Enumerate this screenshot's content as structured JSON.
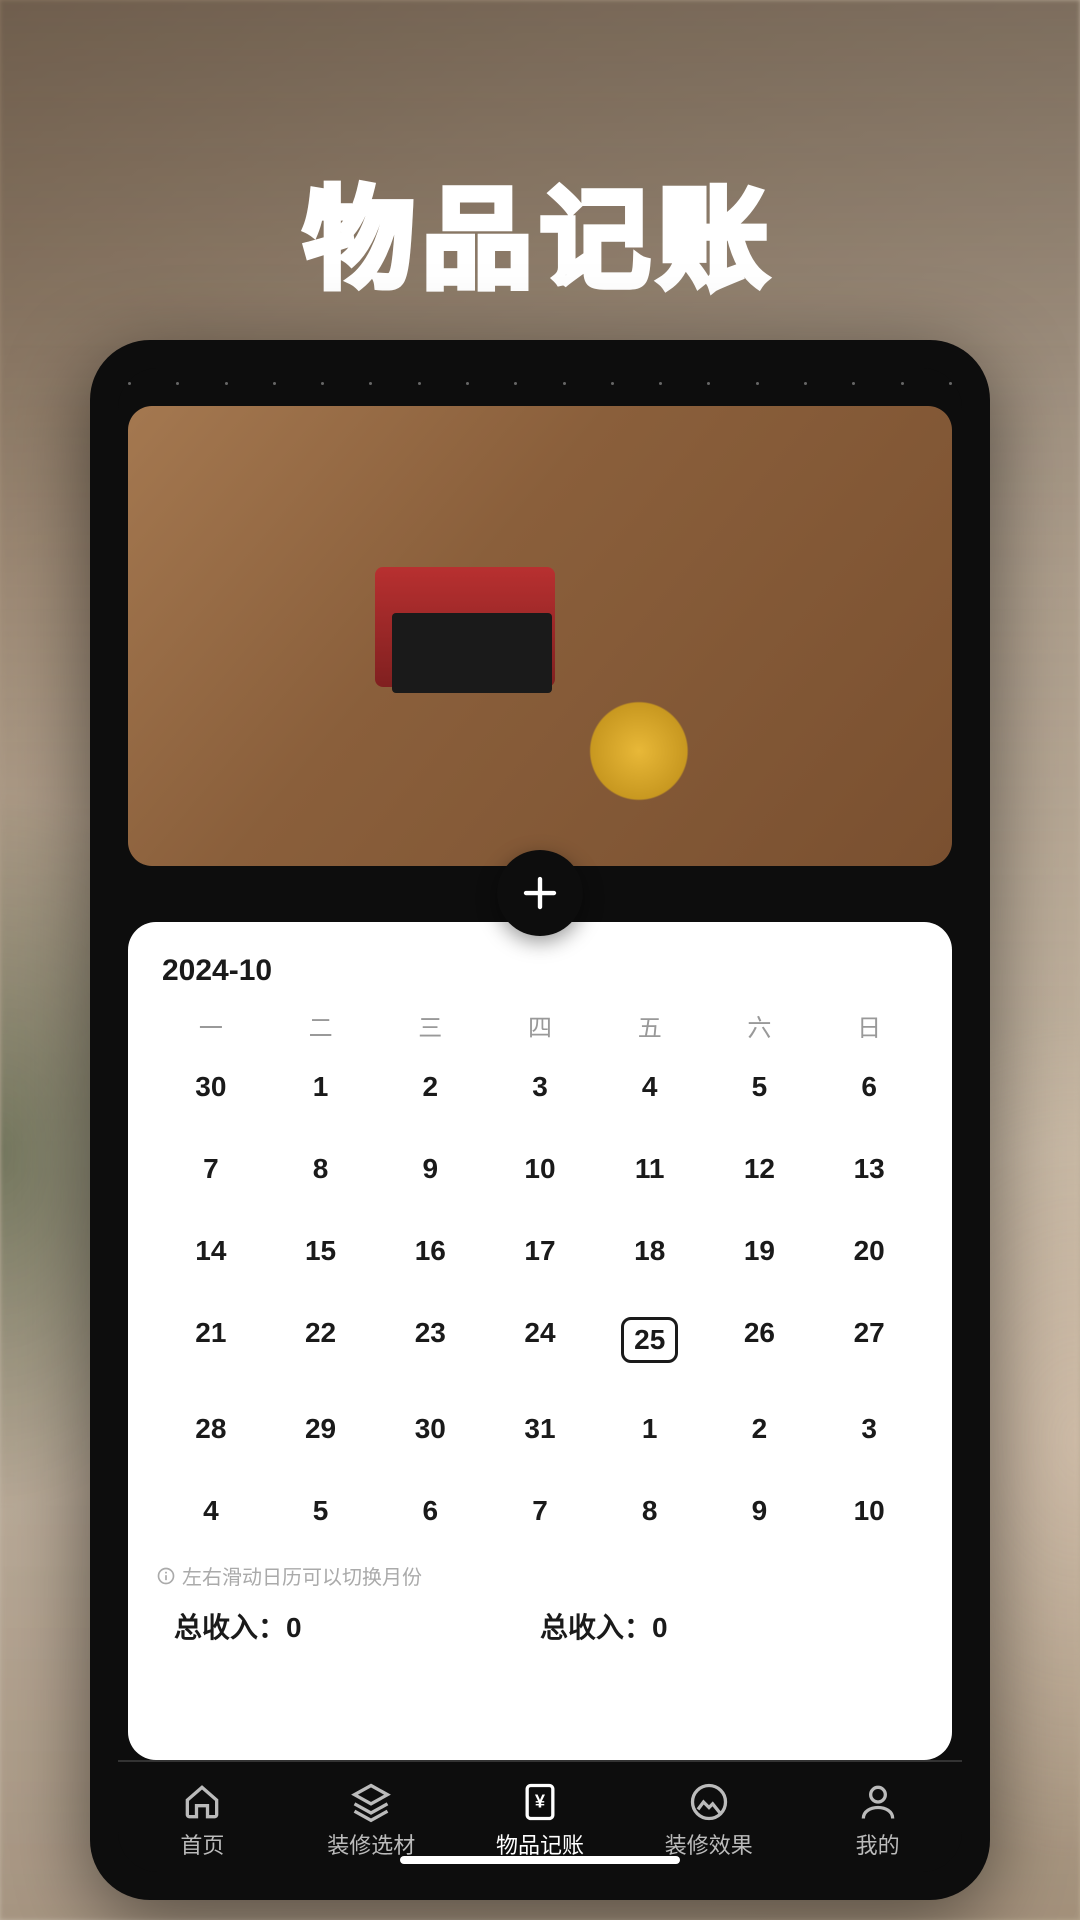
{
  "page_title": "物品记账",
  "calendar": {
    "month_label": "2024-10",
    "weekdays": [
      "一",
      "二",
      "三",
      "四",
      "五",
      "六",
      "日"
    ],
    "days": [
      {
        "n": "30"
      },
      {
        "n": "1"
      },
      {
        "n": "2"
      },
      {
        "n": "3"
      },
      {
        "n": "4"
      },
      {
        "n": "5"
      },
      {
        "n": "6"
      },
      {
        "n": "7"
      },
      {
        "n": "8"
      },
      {
        "n": "9"
      },
      {
        "n": "10"
      },
      {
        "n": "11"
      },
      {
        "n": "12"
      },
      {
        "n": "13"
      },
      {
        "n": "14"
      },
      {
        "n": "15"
      },
      {
        "n": "16"
      },
      {
        "n": "17"
      },
      {
        "n": "18"
      },
      {
        "n": "19"
      },
      {
        "n": "20"
      },
      {
        "n": "21"
      },
      {
        "n": "22"
      },
      {
        "n": "23"
      },
      {
        "n": "24"
      },
      {
        "n": "25",
        "today": true
      },
      {
        "n": "26"
      },
      {
        "n": "27"
      },
      {
        "n": "28"
      },
      {
        "n": "29"
      },
      {
        "n": "30"
      },
      {
        "n": "31"
      },
      {
        "n": "1"
      },
      {
        "n": "2"
      },
      {
        "n": "3"
      },
      {
        "n": "4"
      },
      {
        "n": "5"
      },
      {
        "n": "6"
      },
      {
        "n": "7"
      },
      {
        "n": "8"
      },
      {
        "n": "9"
      },
      {
        "n": "10"
      }
    ],
    "hint": "左右滑动日历可以切换月份"
  },
  "totals": {
    "left_label": "总收入：",
    "left_value": "0",
    "right_label": "总收入：",
    "right_value": "0"
  },
  "nav": {
    "items": [
      {
        "label": "首页",
        "icon": "home"
      },
      {
        "label": "装修选材",
        "icon": "layers"
      },
      {
        "label": "物品记账",
        "icon": "ledger",
        "active": true
      },
      {
        "label": "装修效果",
        "icon": "image"
      },
      {
        "label": "我的",
        "icon": "user"
      }
    ]
  }
}
